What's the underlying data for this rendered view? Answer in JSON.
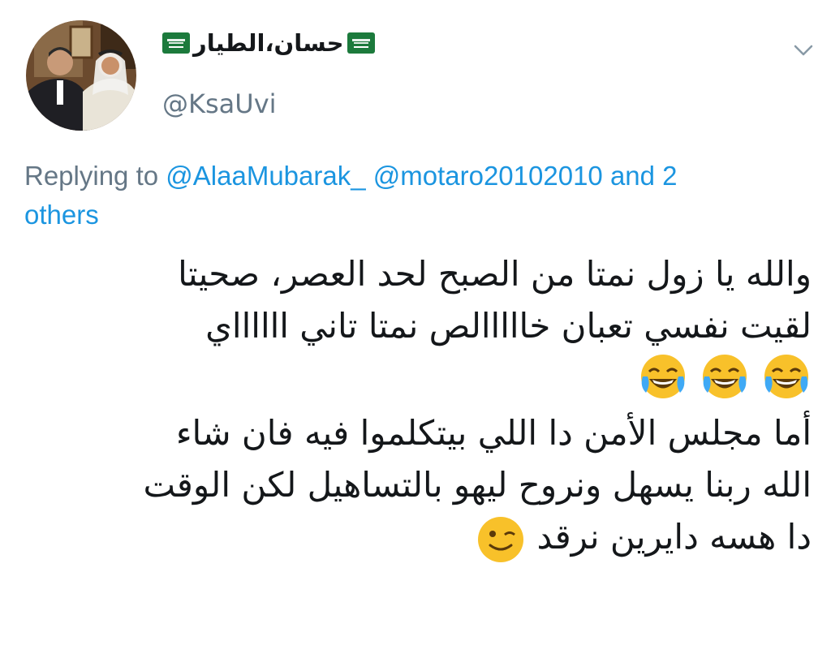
{
  "user": {
    "display_name": "حسان،الطيار",
    "handle": "@KsaUvi"
  },
  "reply": {
    "prefix": "Replying to",
    "mention_1": "@AlaaMubarak_",
    "mention_2": "@motaro20102010",
    "and_others": "and 2",
    "others": "others"
  },
  "tweet": {
    "line_1": "والله يا زول نمتا من الصبح لحد العصر، صحيتا",
    "line_2": "لقيت نفسي تعبان خااااالص نمتا تاني ااااااي",
    "line_4": "أما مجلس الأمن دا اللي بيتكلموا فيه فان شاء",
    "line_5": "الله ربنا يسهل ونروح ليهو بالتساهيل لكن الوقت",
    "line_6": "دا هسه دايرين نرقد"
  },
  "icons": {
    "flag_left": "saudi-flag-icon",
    "flag_right": "saudi-flag-icon",
    "laugh": "face-with-tears-of-joy-icon",
    "wink": "winking-face-icon",
    "chevron": "chevron-down-icon"
  },
  "colors": {
    "text": "#14171a",
    "secondary": "#657786",
    "link": "#1b95e0",
    "flag_green": "#1c7a3c"
  }
}
